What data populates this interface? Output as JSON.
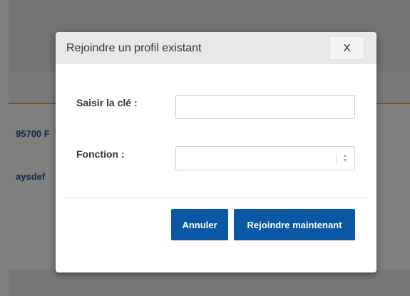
{
  "background": {
    "address_fragment": "95700 F",
    "link_fragment": "aysdef"
  },
  "dialog": {
    "title": "Rejoindre un profil existant",
    "close_label": "X",
    "key_label": "Saisir la clé :",
    "key_value": "",
    "function_label": "Fonction :",
    "function_selected": "",
    "function_arrows": "▲▼",
    "cancel_label": "Annuler",
    "join_label": "Rejoindre maintenant"
  },
  "colors": {
    "primary_button": "#0a57a4",
    "link_text": "#1f4f8f",
    "accent_line": "#e3a13a"
  }
}
